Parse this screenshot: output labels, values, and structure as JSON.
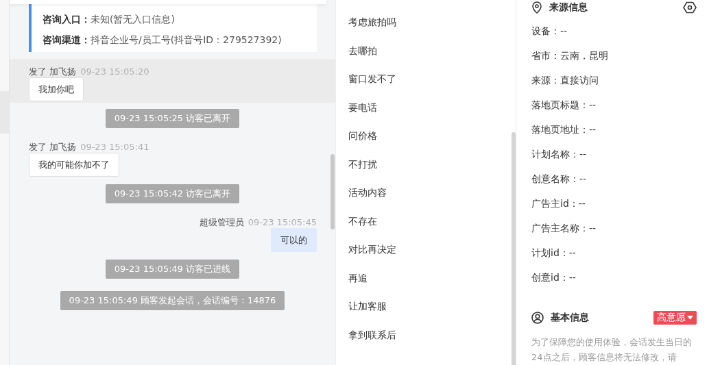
{
  "consult_info": [
    {
      "label": "咨询入口：",
      "value": "未知(暂无入口信息)"
    },
    {
      "label": "咨询渠道：",
      "value": "抖音企业号/员工号(抖音号ID：279527392)"
    }
  ],
  "messages": [
    {
      "kind": "received",
      "highlighted": true,
      "sender": "发了 加飞扬",
      "time": "09-23 15:05:20",
      "text": "我加你吧"
    },
    {
      "kind": "system",
      "text": "09-23 15:05:25 访客已离开"
    },
    {
      "kind": "received",
      "highlighted": false,
      "sender": "发了 加飞扬",
      "time": "09-23 15:05:41",
      "text": "我的可能你加不了"
    },
    {
      "kind": "system",
      "text": "09-23 15:05:42 访客已离开"
    },
    {
      "kind": "sent",
      "highlighted": false,
      "sender": "超级管理员",
      "time": "09-23 15:05:45",
      "text": "可以的"
    },
    {
      "kind": "system",
      "text": "09-23 15:05:49 访客已进线"
    },
    {
      "kind": "system",
      "text": "09-23 15:05:49 顾客发起会话，会话编号：14876"
    }
  ],
  "quick_replies": [
    "考虑旅拍吗",
    "去哪拍",
    "窗口发不了",
    "要电话",
    "问价格",
    "不打扰",
    "活动内容",
    "不存在",
    "对比再决定",
    "再追",
    "让加客服",
    "拿到联系后"
  ],
  "source_info": {
    "title": "来源信息",
    "fields": [
      "设备：--",
      "省市：云南，昆明",
      "来源：直接访问",
      "落地页标题：--",
      "落地页地址：--",
      "计划名称：--",
      "创意名称：--",
      "广告主id：--",
      "广告主名称：--",
      "计划id：--",
      "创意id：--"
    ]
  },
  "basic_info": {
    "title": "基本信息",
    "intent_badge": "高意愿",
    "notice": "为了保障您的使用体验，会话发生当日的24点之后，顾客信息将无法修改，请"
  }
}
